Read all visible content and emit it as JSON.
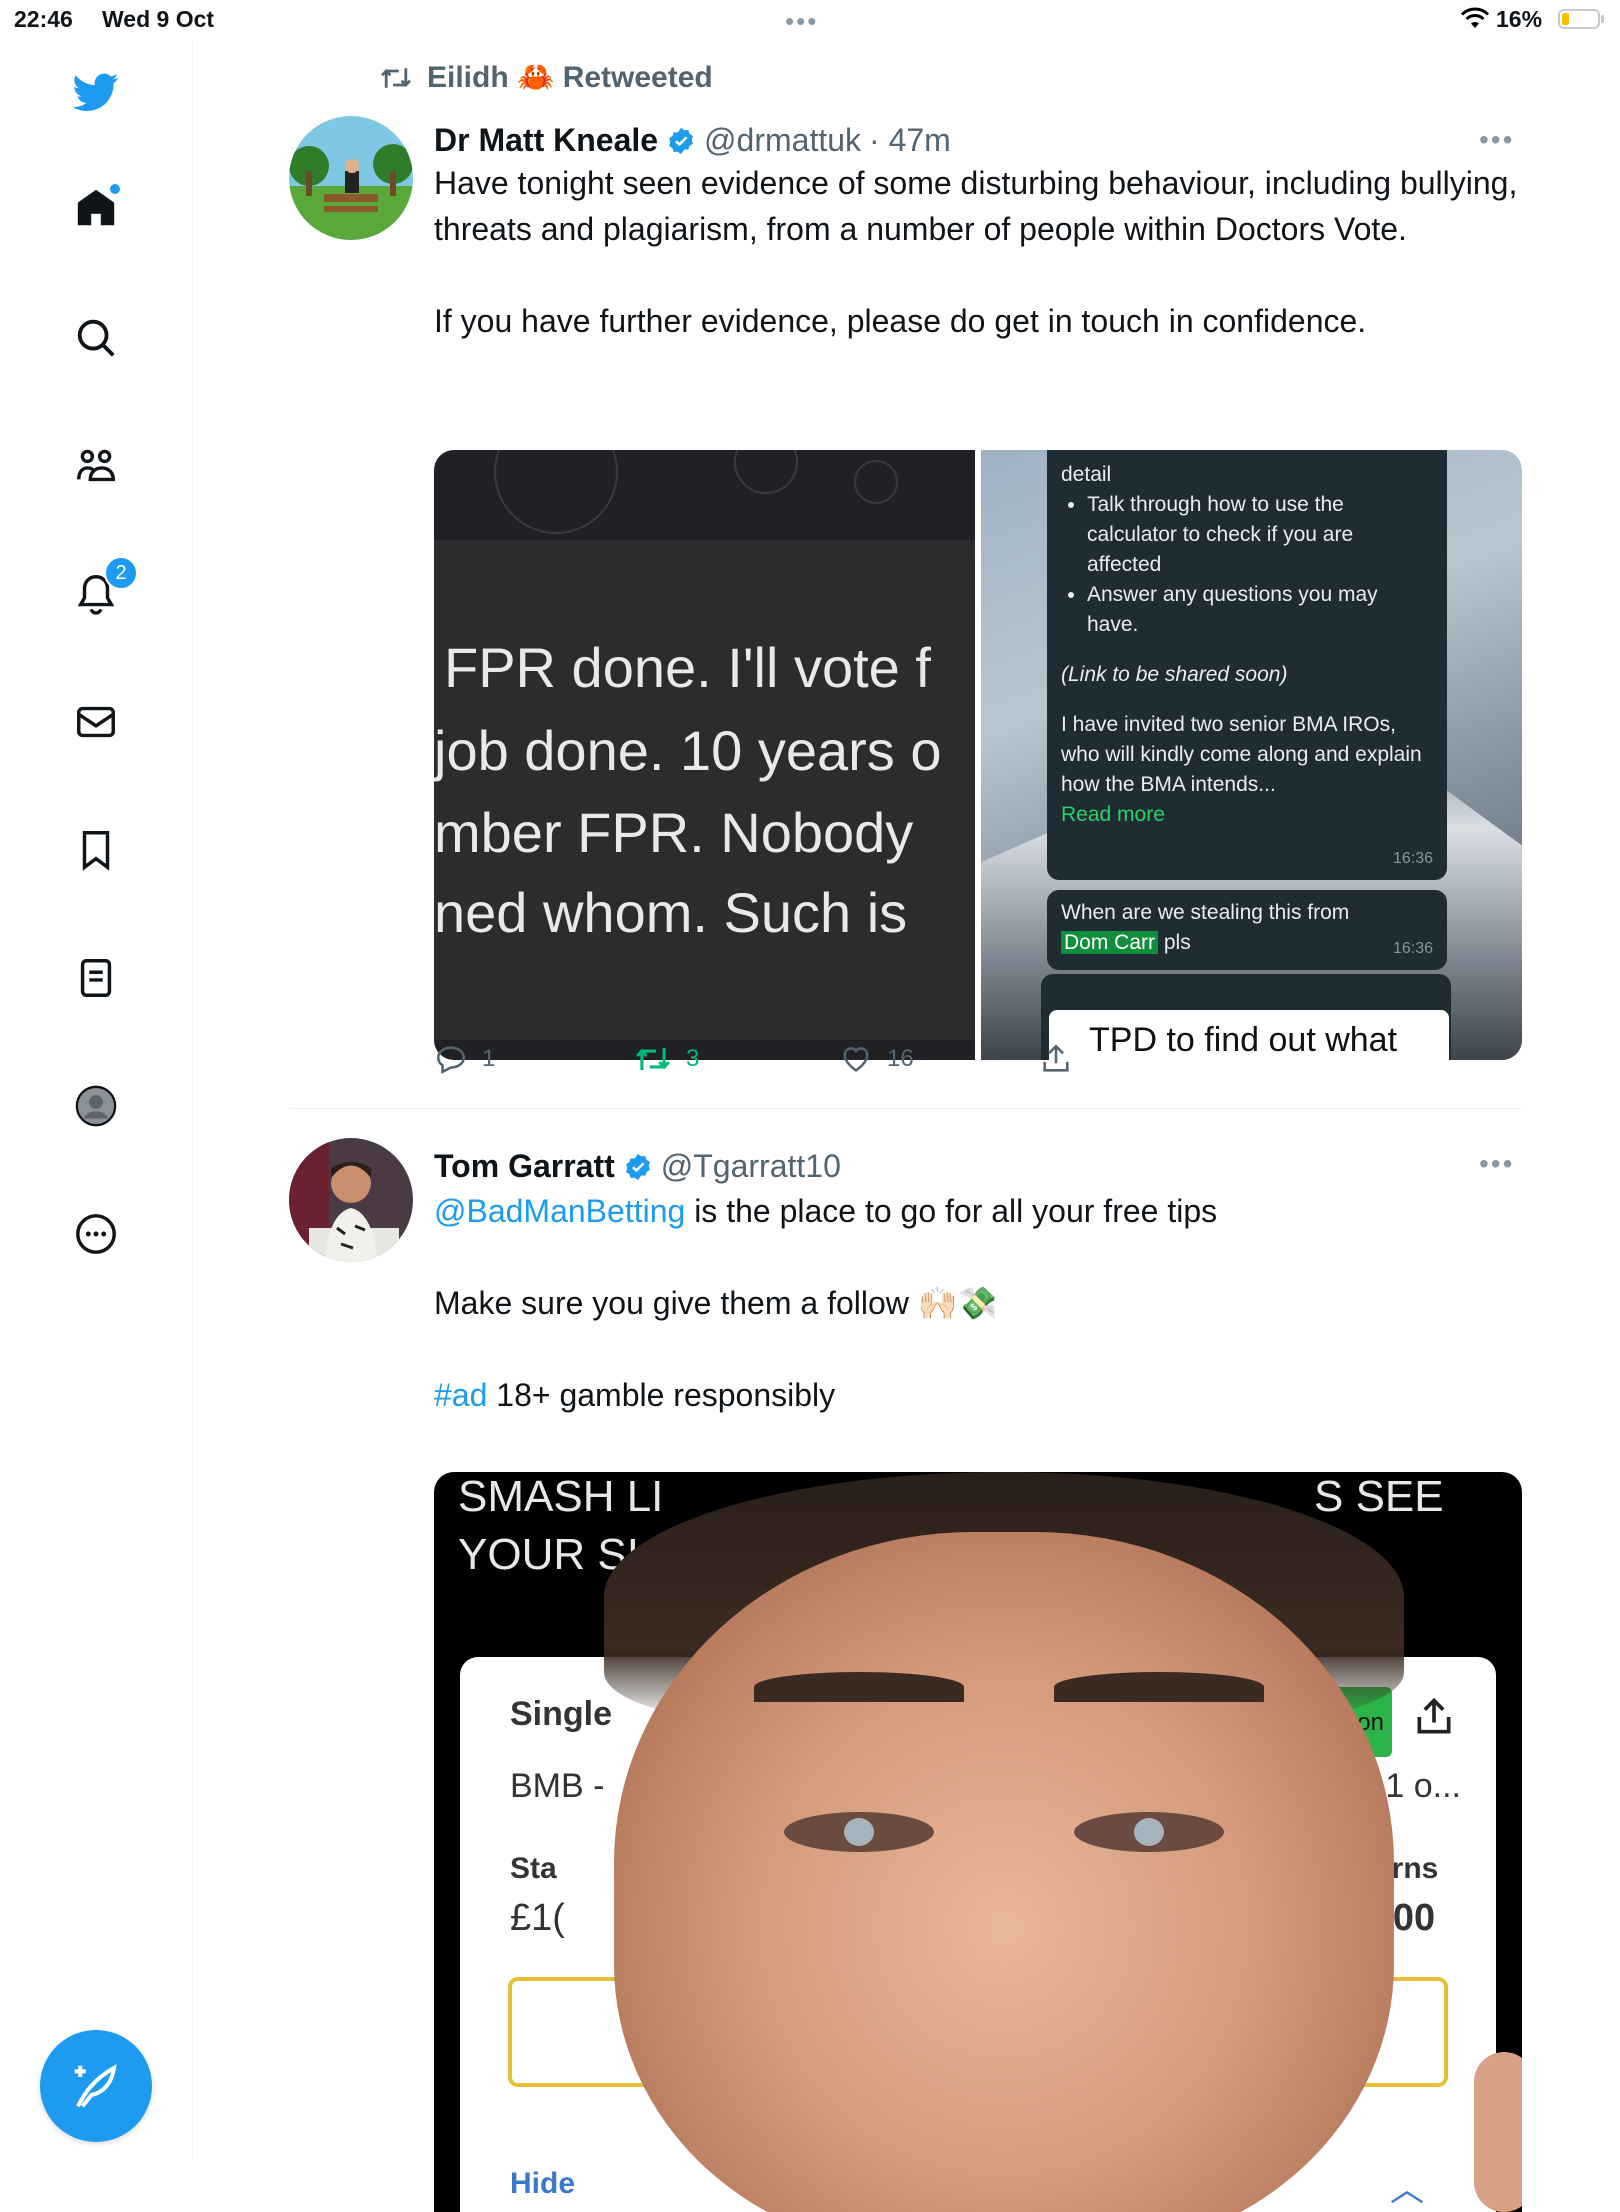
{
  "status_bar": {
    "time": "22:46",
    "date": "Wed 9 Oct",
    "battery": "16%"
  },
  "sidebar": {
    "items": [
      {
        "name": "home",
        "icon": "home-icon"
      },
      {
        "name": "explore",
        "icon": "search-icon"
      },
      {
        "name": "communities",
        "icon": "communities-icon"
      },
      {
        "name": "notifications",
        "icon": "bell-icon",
        "badge": "2"
      },
      {
        "name": "messages",
        "icon": "mail-icon"
      },
      {
        "name": "bookmarks",
        "icon": "bookmark-icon"
      },
      {
        "name": "lists",
        "icon": "list-icon"
      },
      {
        "name": "profile",
        "icon": "profile-icon"
      },
      {
        "name": "more",
        "icon": "more-circle-icon"
      }
    ],
    "compose_icon": "compose-feather-icon",
    "accent": "#1d9bf0"
  },
  "tweets": [
    {
      "retweeted_by": "Eilidh 🦀 Retweeted",
      "name": "Dr Matt Kneale",
      "handle": "@drmattuk",
      "time": "· 47m",
      "text_lines": [
        "Have tonight seen evidence of some disturbing behaviour, including bullying, threats and plagiarism, from a number of people within Doctors Vote.",
        "If you have further evidence, please do get in touch in confidence."
      ],
      "media_left_lines": [
        "FPR done. I'll vote f",
        "job done. 10 years o",
        "mber FPR. Nobody",
        "ned whom. Such is"
      ],
      "media_right": {
        "bubble1_top": "detail",
        "bubble1_items": [
          "Talk through how to use the calculator to check if you are affected",
          "Answer any questions you may have."
        ],
        "bubble1_link": "(Link to be shared soon)",
        "bubble1_body": "I have invited two senior BMA IROs, who will kindly come along and explain how the BMA intends...",
        "bubble1_read_more": "Read more",
        "bubble1_time": "16:36",
        "bubble2_text_1": "When are we stealing this from",
        "bubble2_highlight": "Dom Carr",
        "bubble2_text_2": " pls",
        "bubble2_time": "16:36",
        "bottom_box": "TPD to find out what"
      },
      "replies": "1",
      "retweets": "3",
      "likes": "16"
    },
    {
      "name": "Tom Garratt",
      "handle": "@Tgarratt10",
      "mention": "@BadManBetting",
      "line1_rest": " is the place to go for all your free tips",
      "line2": "Make sure you give them a follow 🙌🏻💸",
      "hashtag": "#ad",
      "line3_rest": " 18+ gamble responsibly",
      "video": {
        "top_left_1": "SMASH LI",
        "top_left_2": "YOUR SI",
        "top_right": "S SEE",
        "card_single": "Single",
        "card_bmb": "BMB -",
        "card_stake": "Sta",
        "card_amount": "£1(",
        "card_right_1": "ve 1 o...",
        "card_returns": "Returns",
        "card_return_amount": "40.00",
        "card_green": "on",
        "card_hide": "Hide"
      }
    }
  ]
}
